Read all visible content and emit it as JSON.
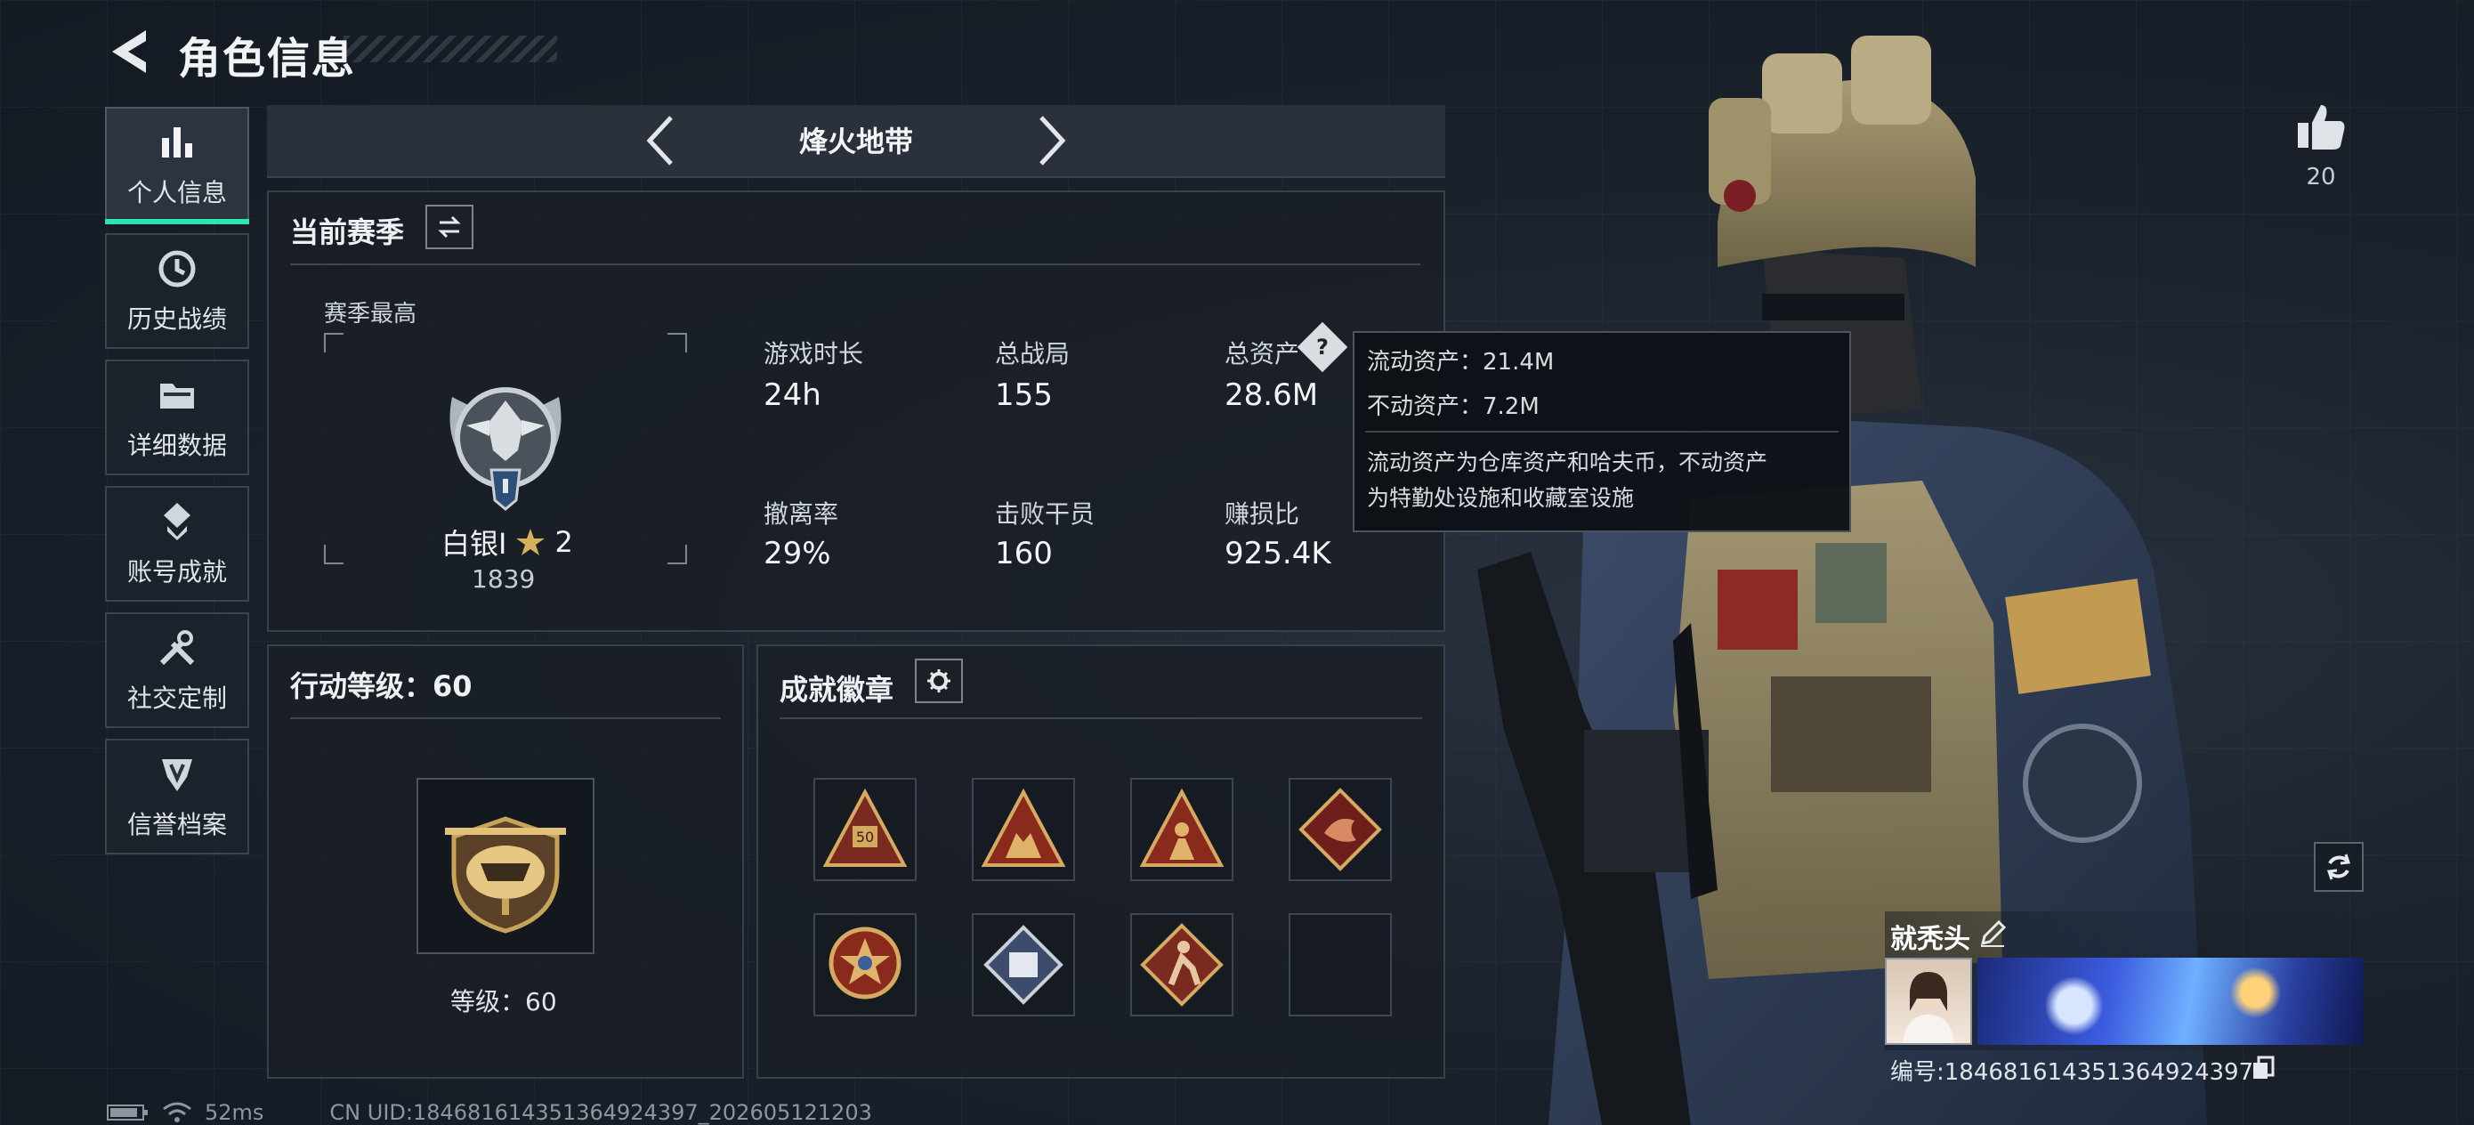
{
  "header": {
    "title": "角色信息"
  },
  "nav": {
    "items": [
      {
        "label": "个人信息",
        "icon": "bar-chart-icon",
        "active": true
      },
      {
        "label": "历史战绩",
        "icon": "history-icon",
        "active": false
      },
      {
        "label": "详细数据",
        "icon": "folder-icon",
        "active": false
      },
      {
        "label": "账号成就",
        "icon": "achievement-icon",
        "active": false
      },
      {
        "label": "社交定制",
        "icon": "tools-icon",
        "active": false
      },
      {
        "label": "信誉档案",
        "icon": "reputation-icon",
        "active": false
      }
    ]
  },
  "mode": {
    "label": "烽火地带"
  },
  "season": {
    "title": "当前赛季",
    "best_label": "赛季最高",
    "rank_name": "白银I",
    "rank_stars": "2",
    "rank_score": "1839",
    "stats": [
      {
        "label": "游戏时长",
        "value": "24h"
      },
      {
        "label": "总战局",
        "value": "155"
      },
      {
        "label": "总资产",
        "value": "28.6M"
      },
      {
        "label": "撤离率",
        "value": "29%"
      },
      {
        "label": "击败干员",
        "value": "160"
      },
      {
        "label": "赚损比",
        "value": "925.4K"
      }
    ]
  },
  "tooltip": {
    "line1": "流动资产：21.4M",
    "line2": "不动资产：7.2M",
    "desc1": "流动资产为仓库资产和哈夫币，不动资产",
    "desc2": "为特勤处设施和收藏室设施"
  },
  "level": {
    "title": "行动等级：60",
    "caption": "等级：60"
  },
  "badges": {
    "title": "成就徽章",
    "slot_label_1": "50"
  },
  "profile": {
    "likes": "20",
    "name": "就秃头",
    "uid_label": "编号:18468161435136492439​7"
  },
  "status": {
    "ping": "52ms",
    "uid_line": "CN UID:18468161435136492439​7_202605121203"
  },
  "colors": {
    "accent": "#2fe3b0",
    "gold": "#c8a35a",
    "badge_red": "#8a1f22"
  }
}
